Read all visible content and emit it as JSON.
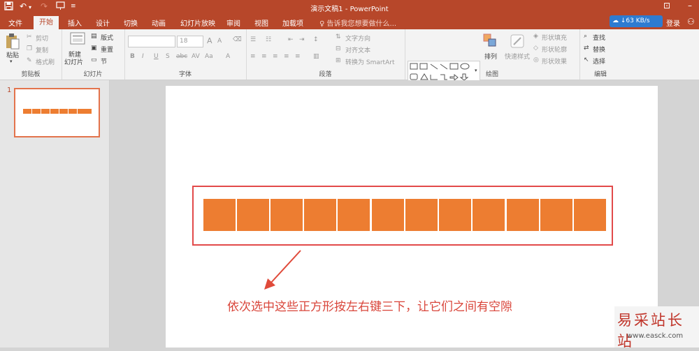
{
  "window": {
    "title": "演示文稿1 - PowerPoint",
    "restore_label": "⊡",
    "minimize_label": "–"
  },
  "quick_access": {
    "save_icon": "save-icon",
    "undo_icon": "undo-icon",
    "redo_icon": "redo-icon",
    "present_icon": "present-from-start-icon",
    "customize_icon": "customize-icon"
  },
  "tabs": [
    "文件",
    "开始",
    "插入",
    "设计",
    "切换",
    "动画",
    "幻灯片放映",
    "审阅",
    "视图",
    "加载项"
  ],
  "active_tab": "开始",
  "tell_me": "告诉我您想要做什么...",
  "net_speed": "63 KB/s",
  "login": "登录",
  "ribbon": {
    "clipboard": {
      "label": "剪贴板",
      "paste": "粘贴",
      "cut": "剪切",
      "copy": "复制",
      "format_painter": "格式刷"
    },
    "slides": {
      "label": "幻灯片",
      "new_slide_line1": "新建",
      "new_slide_line2": "幻灯片",
      "layout": "版式",
      "reset": "重置",
      "section": "节"
    },
    "font": {
      "label": "字体",
      "font_name": "",
      "font_size": "18",
      "bold": "B",
      "italic": "I",
      "underline": "U",
      "shadow": "S",
      "strike": "abc",
      "spacing": "AV",
      "case": "Aa",
      "grow": "A",
      "shrink": "A"
    },
    "paragraph": {
      "label": "段落",
      "text_direction": "文字方向",
      "align_text": "对齐文本",
      "smartart": "转换为 SmartArt"
    },
    "drawing": {
      "label": "绘图",
      "arrange": "排列",
      "quick_styles": "快速样式",
      "shape_fill": "形状填充",
      "shape_outline": "形状轮廓",
      "shape_effects": "形状效果"
    },
    "editing": {
      "label": "编辑",
      "find": "查找",
      "replace": "替换",
      "select": "选择"
    }
  },
  "thumbnail": {
    "number": "1"
  },
  "slide": {
    "square_color": "#ED7D31",
    "selection_color": "#E24A4A",
    "caption": "依次选中这些正方形按左右键三下，让它们之间有空隙"
  },
  "watermark": {
    "line1": "易采站长站",
    "line2": "www.easck.com"
  }
}
